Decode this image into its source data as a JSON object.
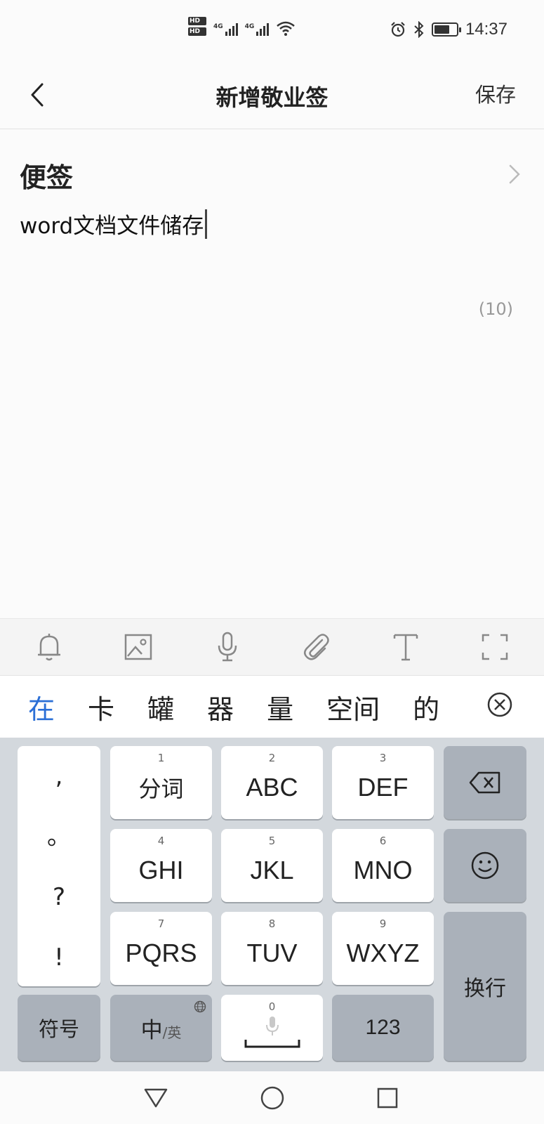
{
  "status_bar": {
    "hd1": "HD",
    "hd2": "HD",
    "net1": "4G",
    "net2": "4G",
    "time": "14:37",
    "battery_level": 0.7
  },
  "header": {
    "title": "新增敬业签",
    "save_label": "保存"
  },
  "note": {
    "category": "便签",
    "content": "word文档文件储存",
    "char_count": "(10)"
  },
  "toolbar": {
    "icons": [
      "bell-icon",
      "image-icon",
      "mic-icon",
      "attachment-icon",
      "text-format-icon",
      "fullscreen-icon"
    ]
  },
  "candidates": [
    "在",
    "卡",
    "罐",
    "器",
    "量",
    "空间",
    "的"
  ],
  "keyboard": {
    "punct": [
      ",",
      "。",
      "?",
      "!"
    ],
    "keys": [
      {
        "num": "1",
        "label": "分词"
      },
      {
        "num": "2",
        "label": "ABC"
      },
      {
        "num": "3",
        "label": "DEF"
      },
      {
        "num": "4",
        "label": "GHI"
      },
      {
        "num": "5",
        "label": "JKL"
      },
      {
        "num": "6",
        "label": "MNO"
      },
      {
        "num": "7",
        "label": "PQRS"
      },
      {
        "num": "8",
        "label": "TUV"
      },
      {
        "num": "9",
        "label": "WXYZ"
      }
    ],
    "symbol_label": "符号",
    "lang_main": "中",
    "lang_sub": "/英",
    "space_num": "0",
    "num_label": "123",
    "enter_label": "换行"
  },
  "colors": {
    "accent": "#2b6fd6",
    "key_dark": "#aab1ba",
    "keyboard_bg": "#d3d8dd"
  }
}
